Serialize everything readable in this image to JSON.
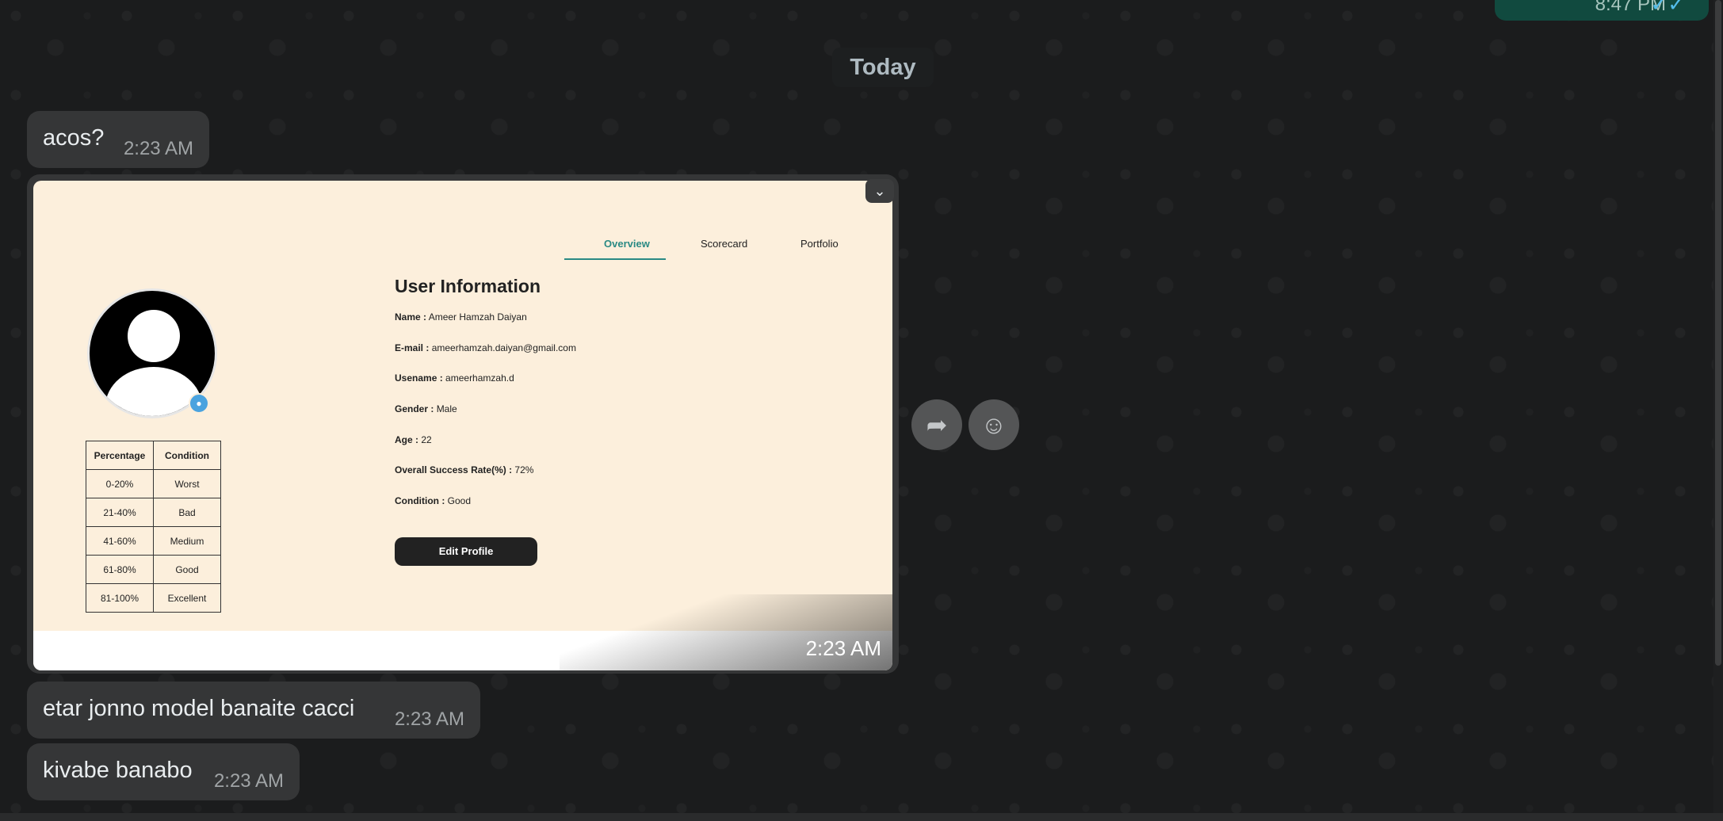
{
  "outgoing_previous": {
    "time": "8:47 PM",
    "status_icon": "double-check-icon"
  },
  "date_separator": "Today",
  "messages": [
    {
      "text": "acos?",
      "time": "2:23 AM"
    },
    {
      "text": "etar jonno model banaite cacci",
      "time": "2:23 AM"
    },
    {
      "text": "kivabe banabo",
      "time": "2:23 AM"
    }
  ],
  "image_message": {
    "time": "2:23 AM",
    "screenshot": {
      "tabs": [
        "Overview",
        "Scorecard",
        "Portfolio"
      ],
      "active_tab": "Overview",
      "title": "User Information",
      "fields": [
        {
          "label": "Name :",
          "value": "Ameer Hamzah Daiyan"
        },
        {
          "label": "E-mail :",
          "value": "ameerhamzah.daiyan@gmail.com"
        },
        {
          "label": "Usename :",
          "value": "ameerhamzah.d"
        },
        {
          "label": "Gender :",
          "value": "Male"
        },
        {
          "label": "Age :",
          "value": "22"
        },
        {
          "label": "Overall Success Rate(%) :",
          "value": "72%"
        },
        {
          "label": "Condition :",
          "value": "Good"
        }
      ],
      "edit_button": "Edit Profile",
      "table": {
        "headers": [
          "Percentage",
          "Condition"
        ],
        "rows": [
          [
            "0-20%",
            "Worst"
          ],
          [
            "21-40%",
            "Bad"
          ],
          [
            "41-60%",
            "Medium"
          ],
          [
            "61-80%",
            "Good"
          ],
          [
            "81-100%",
            "Excellent"
          ]
        ]
      }
    }
  },
  "icons": {
    "forward": "forward-icon",
    "react": "emoji-icon",
    "menu": "chevron-down-icon",
    "camera": "camera-icon"
  },
  "colors": {
    "background": "#1b1c1d",
    "incoming_bubble": "#353637",
    "outgoing_bubble": "#114a3f",
    "accent_tab": "#2a8a84"
  }
}
